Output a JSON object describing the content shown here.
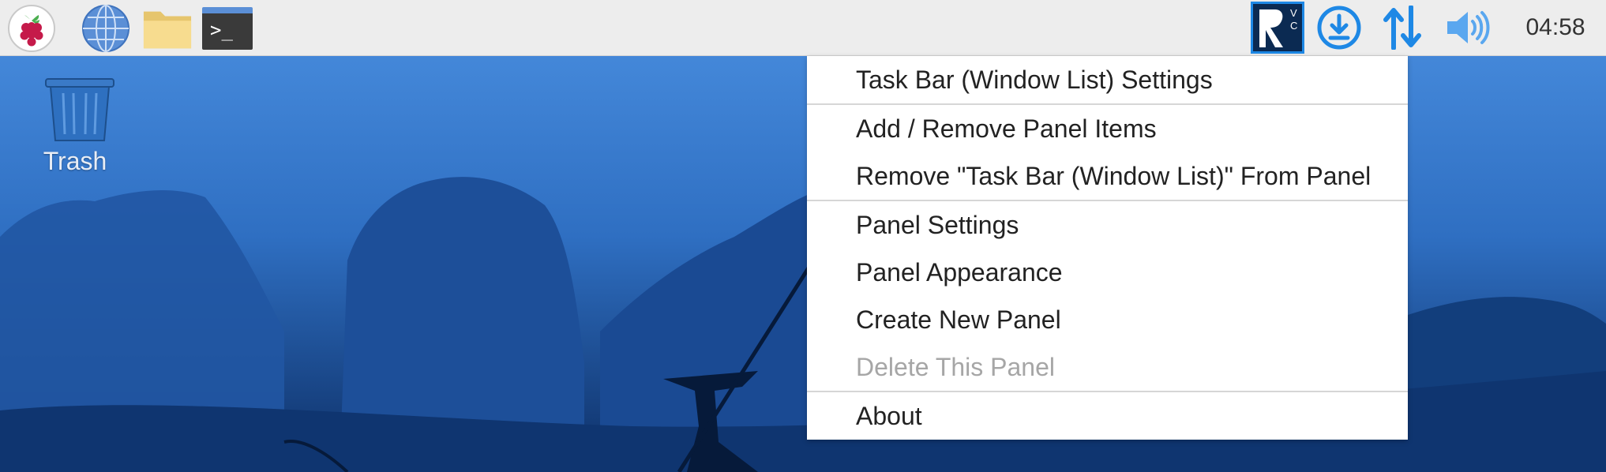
{
  "taskbar": {
    "launchers": {
      "menu_icon": "raspberry-pi-icon",
      "browser_icon": "globe-icon",
      "files_icon": "folder-icon",
      "terminal_icon": "terminal-icon",
      "terminal_prompt": ">_"
    },
    "tray": {
      "vnc_label": "V C",
      "vnc_icon": "vnc-icon",
      "updater_icon": "download-icon",
      "network_icon": "network-arrows-icon",
      "volume_icon": "speaker-icon"
    },
    "clock": "04:58"
  },
  "desktop": {
    "trash_label": "Trash"
  },
  "context_menu": {
    "items": [
      {
        "label": "Task Bar (Window List) Settings",
        "enabled": true
      },
      {
        "label": "Add / Remove Panel Items",
        "enabled": true
      },
      {
        "label": "Remove \"Task Bar (Window List)\" From Panel",
        "enabled": true
      },
      {
        "label": "Panel Settings",
        "enabled": true
      },
      {
        "label": "Panel Appearance",
        "enabled": true
      },
      {
        "label": "Create New Panel",
        "enabled": true
      },
      {
        "label": "Delete This Panel",
        "enabled": false
      },
      {
        "label": "About",
        "enabled": true
      }
    ]
  },
  "colors": {
    "panel_bg": "#ededed",
    "accent_blue": "#1e88e5",
    "vnc_bg": "#0b2a52",
    "menu_disabled": "#a6a6a6"
  }
}
